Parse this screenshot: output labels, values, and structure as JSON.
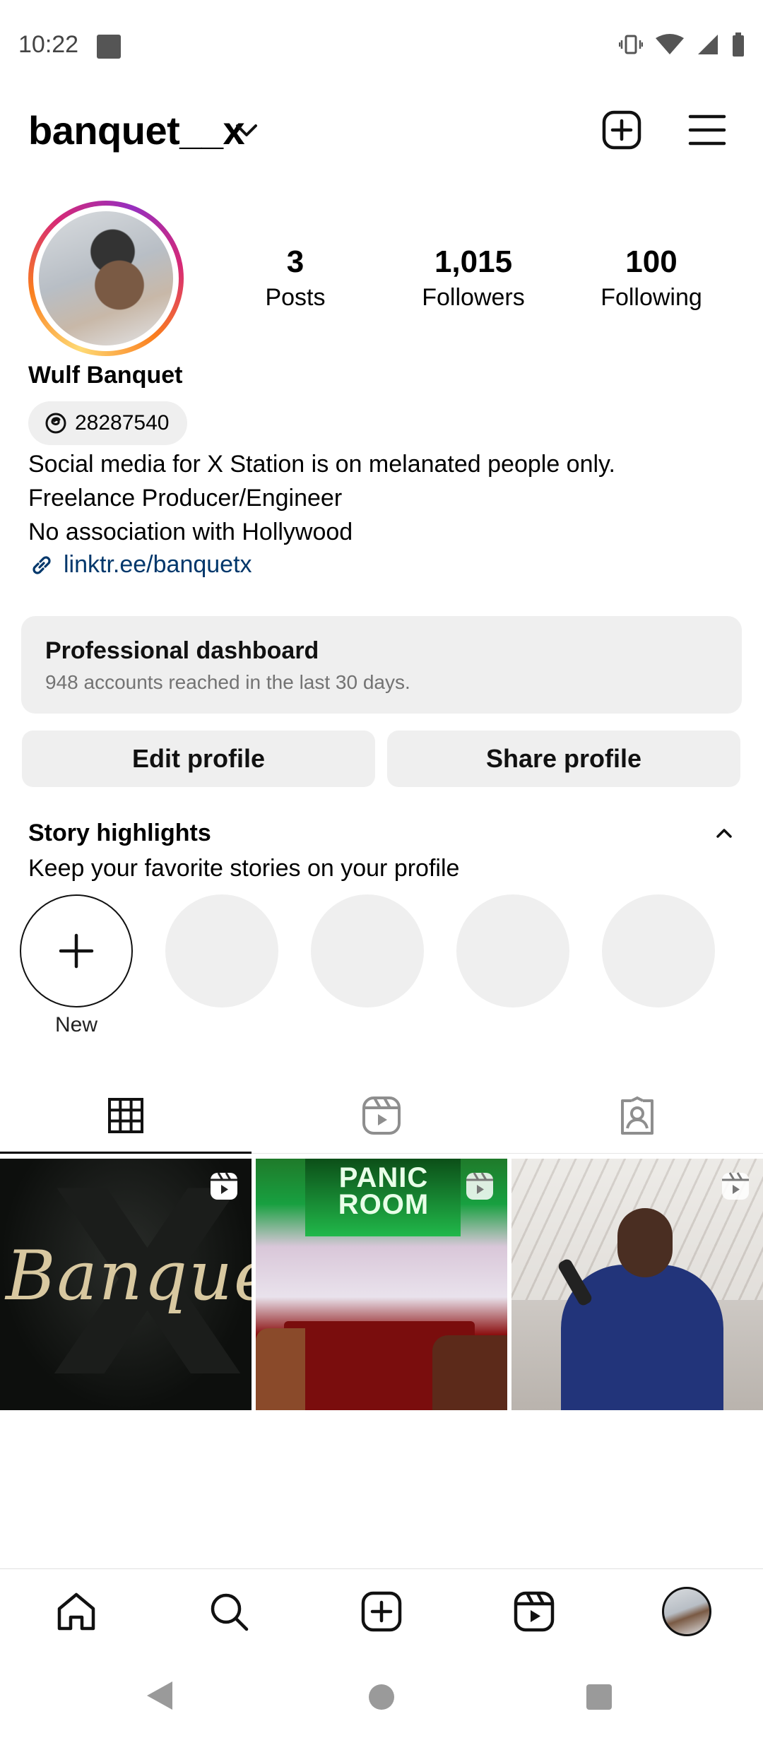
{
  "status_bar": {
    "time": "10:22"
  },
  "header": {
    "username": "banquet__x"
  },
  "profile": {
    "display_name": "Wulf Banquet",
    "threads_id": "28287540",
    "bio_lines": [
      "Social media for X Station is on melanated people only.",
      "Freelance Producer/Engineer",
      "No association with Hollywood"
    ],
    "link": "linktr.ee/banquetx"
  },
  "stats": {
    "posts": {
      "value": "3",
      "label": "Posts"
    },
    "followers": {
      "value": "1,015",
      "label": "Followers"
    },
    "following": {
      "value": "100",
      "label": "Following"
    }
  },
  "dashboard": {
    "title": "Professional dashboard",
    "subtitle": "948 accounts reached in the last 30 days."
  },
  "buttons": {
    "edit": "Edit profile",
    "share": "Share profile"
  },
  "highlights": {
    "title": "Story highlights",
    "subtitle": "Keep your favorite stories on your profile",
    "new_label": "New"
  },
  "posts": {
    "post1_word": "Banquet",
    "post2_banner": "PANIC ROOM"
  },
  "icons": {
    "header": [
      "chevron-down-icon",
      "create-plus-icon",
      "hamburger-menu-icon"
    ],
    "tabs": [
      "grid-icon",
      "reels-icon",
      "tagged-icon"
    ],
    "nav": [
      "home-icon",
      "search-icon",
      "create-icon",
      "reels-icon",
      "profile-avatar"
    ]
  },
  "colors": {
    "link": "#00376b",
    "pill_bg": "#efefef",
    "story_ring": [
      "#feda75",
      "#fa7e1e",
      "#d62976",
      "#962fbf"
    ]
  }
}
